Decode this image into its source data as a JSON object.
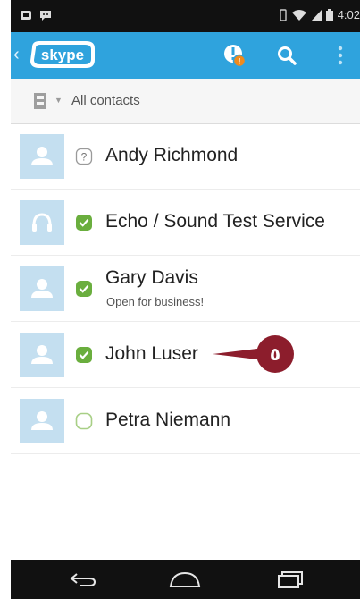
{
  "status_bar": {
    "time": "4:02",
    "icons": [
      "notification-icon",
      "chat-icon",
      "vibrate-icon",
      "wifi-icon",
      "signal-icon",
      "battery-icon"
    ]
  },
  "app_bar": {
    "logo_text": "skype",
    "notification_badge": "!",
    "icons": [
      "back-chevron-icon",
      "notification-icon",
      "search-icon",
      "overflow-menu-icon"
    ],
    "accent_color": "#2fa3dd",
    "badge_color": "#f08a1c"
  },
  "filter": {
    "label": "All contacts",
    "icon": "contacts-book-icon"
  },
  "contacts": [
    {
      "name": "Andy Richmond",
      "mood": "",
      "status": "unknown",
      "avatar": "person-icon"
    },
    {
      "name": "Echo / Sound Test Service",
      "mood": "",
      "status": "online",
      "avatar": "headset-icon"
    },
    {
      "name": "Gary Davis",
      "mood": "Open for business!",
      "status": "online",
      "avatar": "person-icon"
    },
    {
      "name": "John Luser",
      "mood": "",
      "status": "online",
      "avatar": "person-icon"
    },
    {
      "name": "Petra Niemann",
      "mood": "",
      "status": "offline",
      "avatar": "person-icon"
    }
  ],
  "status_colors": {
    "online": "#6aae3e",
    "offline": "#a8cf86",
    "unknown": "#9a9a9a"
  },
  "callout": {
    "label": "٥",
    "color": "#8c1d2c"
  },
  "nav_bar": {
    "icons": [
      "back-icon",
      "home-icon",
      "recents-icon"
    ]
  }
}
